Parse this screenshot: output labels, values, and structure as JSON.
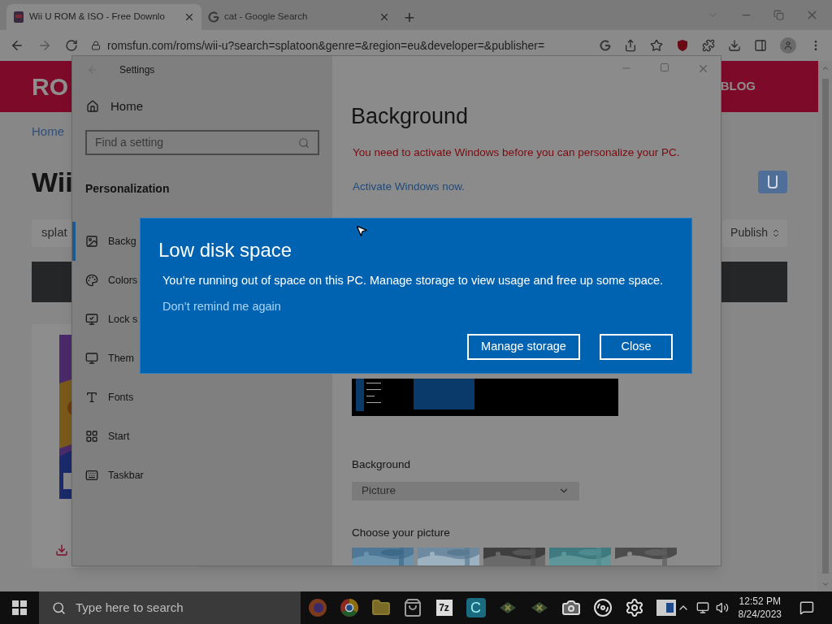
{
  "browser": {
    "tabs": [
      {
        "title": "Wii U ROM & ISO - Free Downlo",
        "selected": true,
        "kind": "site"
      },
      {
        "title": "cat - Google Search",
        "selected": false,
        "kind": "google"
      }
    ],
    "new_tab": "+",
    "url": "romsfun.com/roms/wii-u?search=splatoon&genre=&region=eu&developer=&publisher="
  },
  "page": {
    "logo": "RO",
    "nav": "BLOG",
    "breadcrumb": "Home",
    "heading": "Wii",
    "search_value": "splat",
    "filter": "Publish"
  },
  "settings": {
    "title": "Settings",
    "home": "Home",
    "search_placeholder": "Find a setting",
    "section": "Personalization",
    "items": [
      {
        "label": "Backg",
        "selected": true
      },
      {
        "label": "Colors",
        "selected": false
      },
      {
        "label": "Lock s",
        "selected": false
      },
      {
        "label": "Them",
        "selected": false
      },
      {
        "label": "Fonts",
        "selected": false
      },
      {
        "label": "Start",
        "selected": false
      },
      {
        "label": "Taskbar",
        "selected": false
      }
    ],
    "heading": "Background",
    "warning": "You need to activate Windows before you can personalize your PC.",
    "activate_link": "Activate Windows now.",
    "background_label": "Background",
    "background_value": "Picture",
    "background_disabled": true,
    "choose_label": "Choose your picture"
  },
  "dialog": {
    "title": "Low disk space",
    "message": "You’re running out of space on this PC. Manage storage to view usage and free up some space.",
    "link": "Don’t remind me again",
    "buttons": [
      "Manage storage",
      "Close"
    ]
  },
  "taskbar": {
    "search_placeholder": "Type here to search",
    "apps": [
      {
        "kind": "firefox"
      },
      {
        "kind": "chrome"
      },
      {
        "kind": "folder"
      },
      {
        "kind": "store"
      },
      {
        "kind": "archive",
        "label": "7z"
      },
      {
        "kind": "letter",
        "label": "C"
      },
      {
        "kind": "game"
      },
      {
        "kind": "game"
      },
      {
        "kind": "camera"
      },
      {
        "kind": "disc"
      },
      {
        "kind": "gear"
      },
      {
        "kind": "window"
      }
    ],
    "time": "12:52 PM",
    "date": "8/24/2023"
  }
}
